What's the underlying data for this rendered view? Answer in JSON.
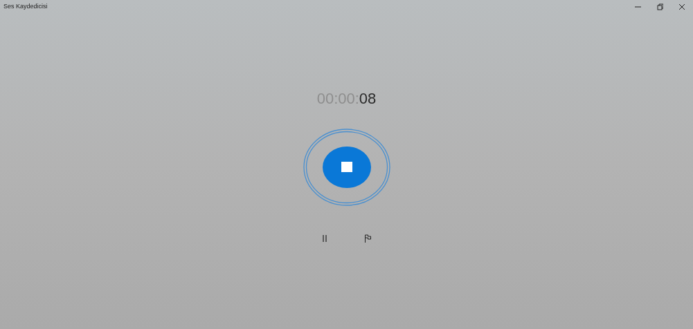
{
  "window": {
    "title": "Ses Kaydedicisi",
    "controls": [
      {
        "kind": "minimize"
      },
      {
        "kind": "restore"
      },
      {
        "kind": "close"
      }
    ]
  },
  "timer": {
    "dim": "00:00:",
    "current": "08"
  },
  "recorder": {
    "recording": true
  },
  "actions": [
    {
      "kind": "pause"
    },
    {
      "kind": "flag"
    }
  ]
}
